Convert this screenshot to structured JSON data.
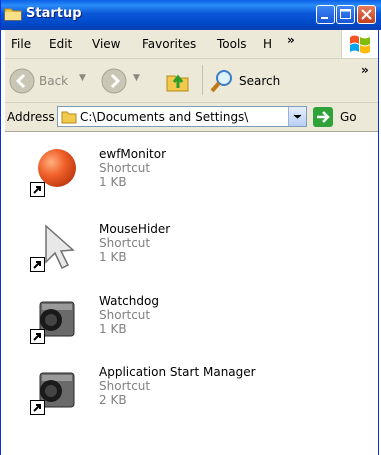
{
  "window": {
    "title": "Startup"
  },
  "menubar": {
    "items": [
      "File",
      "Edit",
      "View",
      "Favorites",
      "Tools",
      "H"
    ],
    "overflow": "»"
  },
  "toolbar": {
    "back_label": "Back",
    "search_label": "Search",
    "overflow": "»"
  },
  "address": {
    "label": "Address",
    "value": "C:\\Documents and Settings\\",
    "go_label": "Go"
  },
  "files": [
    {
      "name": "ewfMonitor",
      "type": "Shortcut",
      "size": "1 KB",
      "icon": "orange-ball-icon"
    },
    {
      "name": "MouseHider",
      "type": "Shortcut",
      "size": "1 KB",
      "icon": "mouse-cursor-icon"
    },
    {
      "name": "Watchdog",
      "type": "Shortcut",
      "size": "1 KB",
      "icon": "camera-icon"
    },
    {
      "name": "Application Start Manager",
      "type": "Shortcut",
      "size": "2 KB",
      "icon": "camera-icon"
    }
  ]
}
